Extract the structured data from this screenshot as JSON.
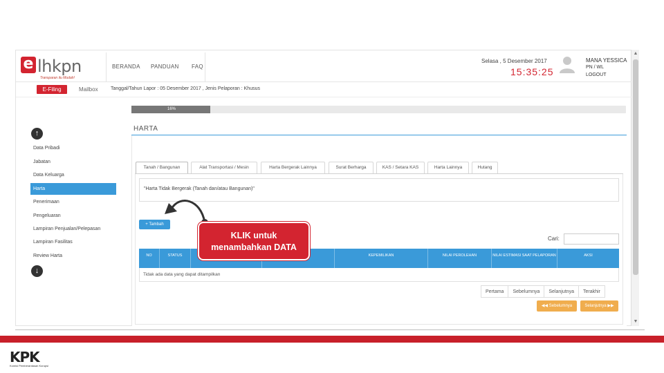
{
  "app": {
    "logo_word": "lhkpn",
    "logo_letter": "e",
    "logo_tagline": "Transparan itu Mudah!"
  },
  "topnav": {
    "items": [
      "BERANDA",
      "PANDUAN",
      "FAQ"
    ]
  },
  "header": {
    "date": "Selasa , 5 Desember 2017",
    "time": "15:35:25",
    "user_name": "MANA YESSICA",
    "user_role": "PN / WL",
    "logout": "LOGOUT"
  },
  "subbar": {
    "efiling": "E-Filing",
    "mailbox": "Mailbox",
    "report_info": "Tanggal/Tahun Lapor : 05 Desember 2017  ,  Jenis Pelaporan : Khusus"
  },
  "progress": {
    "label": "16%",
    "value": 16
  },
  "section_title": "HARTA",
  "sidebar": {
    "items": [
      {
        "label": "Data Pribadi",
        "active": false
      },
      {
        "label": "Jabatan",
        "active": false
      },
      {
        "label": "Data Keluarga",
        "active": false
      },
      {
        "label": "Harta",
        "active": true
      },
      {
        "label": "Penerimaan",
        "active": false
      },
      {
        "label": "Pengeluaran",
        "active": false
      },
      {
        "label": "Lampiran Penjualan/Pelepasan",
        "active": false
      },
      {
        "label": "Lampiran Fasilitas",
        "active": false
      },
      {
        "label": "Review Harta",
        "active": false
      }
    ]
  },
  "tabs": [
    "Tanah / Bangunan",
    "Alat Transportasi / Mesin",
    "Harta Bergerak Lainnya",
    "Surat Berharga",
    "KAS / Setara KAS",
    "Harta Lainnya",
    "Hutang"
  ],
  "section_box_title": "\"Harta Tidak Bergerak (Tanah dan/atau Bangunan)\"",
  "tambah_button": "+ Tambah",
  "search": {
    "label": "Cari:",
    "placeholder": ""
  },
  "table": {
    "headers": [
      "NO",
      "STATUS",
      "",
      "KEPEMILIKAN",
      "NILAI PEROLEHAN",
      "NILAI ESTIMASI SAAT PELAPORAN",
      "AKSI"
    ],
    "empty_text": "Tidak ada data yang dapat ditampilkan"
  },
  "pagination": [
    "Pertama",
    "Sebelumnya",
    "Selanjutnya",
    "Terakhir"
  ],
  "nav_buttons": {
    "prev": "◀◀ Sebelumnya",
    "next": "Selanjutnya ▶▶"
  },
  "annotation": {
    "line1": "KLIK untuk",
    "line2": "menambahkan DATA"
  },
  "footer": {
    "kpk": "KPK",
    "kpk_sub": "Komisi Pemberantasan Korupsi"
  },
  "colors": {
    "brand_red": "#d32430",
    "accent_blue": "#3a9ad9",
    "orange": "#f0ad4e"
  }
}
